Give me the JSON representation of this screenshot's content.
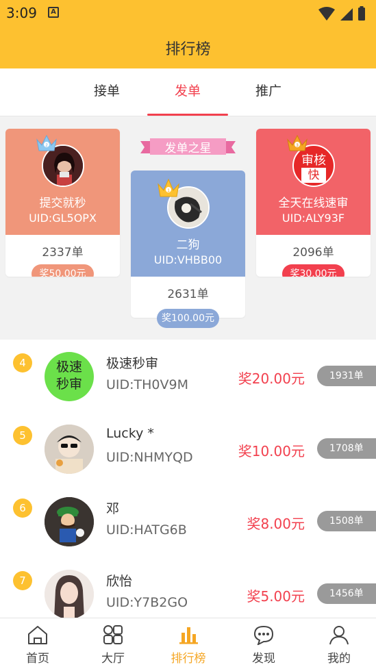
{
  "status_bar": {
    "time": "3:09",
    "notif_letter": "A"
  },
  "header": {
    "title": "排行榜"
  },
  "tabs": [
    {
      "label": "接单",
      "active": false
    },
    {
      "label": "发单",
      "active": true
    },
    {
      "label": "推广",
      "active": false
    }
  ],
  "podium": {
    "star_banner": "发单之星",
    "first": {
      "rank": "1",
      "name": "二狗",
      "uid": "UID:VHBB00",
      "count": "2631单",
      "prize": "奖100.00元",
      "color": "#8BA8D8"
    },
    "second": {
      "rank": "2",
      "name": "提交就秒",
      "uid": "UID:GL5OPX",
      "count": "2337单",
      "prize": "奖50.00元",
      "color": "#F0967A"
    },
    "third": {
      "rank": "3",
      "name": "全天在线速审",
      "uid": "UID:ALY93F",
      "count": "2096单",
      "prize": "奖30.00元",
      "color": "#F26368",
      "avatar_text_top": "审核",
      "avatar_text_bottom": "快"
    }
  },
  "ranking_list": [
    {
      "rank": "4",
      "name": "极速秒审",
      "uid": "UID:TH0V9M",
      "prize": "奖20.00元",
      "count": "1931单",
      "avatar_text": "极速秒审"
    },
    {
      "rank": "5",
      "name": "Lucky  *",
      "uid": "UID:NHMYQD",
      "prize": "奖10.00元",
      "count": "1708单"
    },
    {
      "rank": "6",
      "name": "邓",
      "uid": "UID:HATG6B",
      "prize": "奖8.00元",
      "count": "1508单"
    },
    {
      "rank": "7",
      "name": "欣怡",
      "uid": "UID:Y7B2GO",
      "prize": "奖5.00元",
      "count": "1456单"
    }
  ],
  "bottom_nav": [
    {
      "label": "首页",
      "icon": "home-icon",
      "active": false
    },
    {
      "label": "大厅",
      "icon": "grid-icon",
      "active": false
    },
    {
      "label": "排行榜",
      "icon": "bar-chart-icon",
      "active": true
    },
    {
      "label": "发现",
      "icon": "chat-bubble-icon",
      "active": false
    },
    {
      "label": "我的",
      "icon": "user-icon",
      "active": false
    }
  ],
  "colors": {
    "brand_yellow": "#FDC130",
    "accent_red": "#F2404E",
    "nav_active": "#F5A623"
  }
}
